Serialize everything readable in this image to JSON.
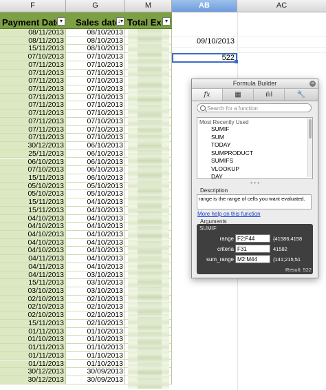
{
  "column_headers": [
    "F",
    "G",
    "M",
    "AB",
    "AC"
  ],
  "table_headers": {
    "payment_date": "Payment Date",
    "sales_date": "Sales date",
    "total_ex": "Total Ex Va"
  },
  "rows": [
    [
      "08/11/2013",
      "08/10/2013"
    ],
    [
      "08/11/2013",
      "08/10/2013"
    ],
    [
      "15/11/2013",
      "08/10/2013"
    ],
    [
      "07/10/2013",
      "07/10/2013"
    ],
    [
      "07/11/2013",
      "07/10/2013"
    ],
    [
      "07/11/2013",
      "07/10/2013"
    ],
    [
      "07/11/2013",
      "07/10/2013"
    ],
    [
      "07/11/2013",
      "07/10/2013"
    ],
    [
      "07/11/2013",
      "07/10/2013"
    ],
    [
      "07/11/2013",
      "07/10/2013"
    ],
    [
      "07/11/2013",
      "07/10/2013"
    ],
    [
      "07/11/2013",
      "07/10/2013"
    ],
    [
      "07/11/2013",
      "07/10/2013"
    ],
    [
      "07/11/2013",
      "07/10/2013"
    ],
    [
      "30/12/2013",
      "06/10/2013"
    ],
    [
      "25/11/2013",
      "06/10/2013"
    ],
    [
      "06/10/2013",
      "06/10/2013"
    ],
    [
      "07/10/2013",
      "06/10/2013"
    ],
    [
      "15/11/2013",
      "06/10/2013"
    ],
    [
      "05/10/2013",
      "05/10/2013"
    ],
    [
      "05/10/2013",
      "05/10/2013"
    ],
    [
      "15/11/2013",
      "04/10/2013"
    ],
    [
      "15/11/2013",
      "04/10/2013"
    ],
    [
      "04/10/2013",
      "04/10/2013"
    ],
    [
      "04/10/2013",
      "04/10/2013"
    ],
    [
      "04/10/2013",
      "04/10/2013"
    ],
    [
      "04/10/2013",
      "04/10/2013"
    ],
    [
      "04/10/2013",
      "04/10/2013"
    ],
    [
      "04/11/2013",
      "04/10/2013"
    ],
    [
      "04/11/2013",
      "04/10/2013"
    ],
    [
      "04/11/2013",
      "03/10/2013"
    ],
    [
      "15/11/2013",
      "03/10/2013"
    ],
    [
      "03/10/2013",
      "03/10/2013"
    ],
    [
      "02/10/2013",
      "02/10/2013"
    ],
    [
      "02/10/2013",
      "02/10/2013"
    ],
    [
      "02/10/2013",
      "02/10/2013"
    ],
    [
      "15/11/2013",
      "02/10/2013"
    ],
    [
      "01/11/2013",
      "01/10/2013"
    ],
    [
      "01/10/2013",
      "01/10/2013"
    ],
    [
      "01/11/2013",
      "01/10/2013"
    ],
    [
      "01/11/2013",
      "01/10/2013"
    ],
    [
      "01/11/2013",
      "01/10/2013"
    ],
    [
      "30/12/2013",
      "30/09/2013"
    ],
    [
      "30/12/2013",
      "30/09/2013"
    ]
  ],
  "cells": {
    "ab_date": "09/10/2013",
    "ab_selected": "522"
  },
  "formula_builder": {
    "title": "Formula Builder",
    "close_glyph": "×",
    "tabs": [
      "fx",
      "▦",
      "ılıl",
      "🔧"
    ],
    "search_placeholder": "Search for a function",
    "list_group": "Most Recently Used",
    "functions": [
      "SUMIF",
      "SUM",
      "TODAY",
      "SUMPRODUCT",
      "SUMIFS",
      "VLOOKUP",
      "DAY"
    ],
    "dots": "• • •",
    "description_title": "Description",
    "description": "range is the range of cells you want evaluated.",
    "help_link": "More help on this function",
    "arguments_title": "Arguments",
    "function_name": "SUMIF",
    "args": [
      {
        "name": "range",
        "input": "F2:F44",
        "value": "{41586;4158"
      },
      {
        "name": "criteria",
        "input": "F31",
        "value": "41582"
      },
      {
        "name": "sum_range",
        "input": "M2:M44",
        "value": "{141;215;51"
      }
    ],
    "result": "Result: 522"
  }
}
